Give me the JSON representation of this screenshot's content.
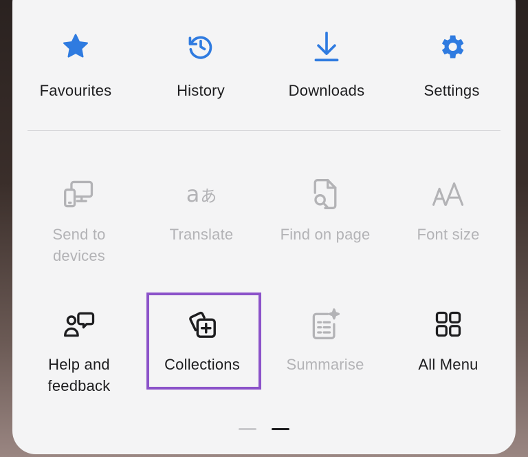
{
  "colors": {
    "accent": "#2f7be0",
    "muted": "#b3b3b6",
    "highlight": "#8b52c9"
  },
  "top_row": [
    {
      "label": "Favourites",
      "icon": "star-icon"
    },
    {
      "label": "History",
      "icon": "history-icon"
    },
    {
      "label": "Downloads",
      "icon": "download-icon"
    },
    {
      "label": "Settings",
      "icon": "gear-icon"
    }
  ],
  "grid": [
    {
      "label_line1": "Send to",
      "label_line2": "devices",
      "icon": "send-to-devices-icon",
      "enabled": false
    },
    {
      "label_line1": "Translate",
      "icon": "translate-icon",
      "enabled": false
    },
    {
      "label_line1": "Find on page",
      "icon": "find-on-page-icon",
      "enabled": false
    },
    {
      "label_line1": "Font size",
      "icon": "font-size-icon",
      "enabled": false
    },
    {
      "label_line1": "Help and",
      "label_line2": "feedback",
      "icon": "help-feedback-icon",
      "enabled": true
    },
    {
      "label_line1": "Collections",
      "icon": "collections-icon",
      "enabled": true,
      "highlighted": true
    },
    {
      "label_line1": "Summarise",
      "icon": "summarise-icon",
      "enabled": false
    },
    {
      "label_line1": "All Menu",
      "icon": "all-menu-icon",
      "enabled": true
    }
  ],
  "pager": {
    "pages": 2,
    "current": 2
  }
}
